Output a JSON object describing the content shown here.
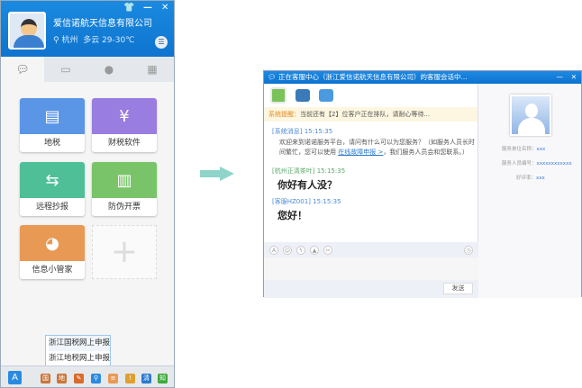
{
  "left_panel": {
    "company": "爱信诺航天信息有限公司",
    "location": "杭州",
    "weather": "多云 29-30℃",
    "tabs": [
      {
        "icon": "chat-icon"
      },
      {
        "icon": "card-icon"
      },
      {
        "icon": "contact-icon"
      },
      {
        "icon": "apps-icon"
      }
    ],
    "tiles": [
      {
        "label": "地税",
        "icon": "tax-doc-icon",
        "color": "#5b95e5"
      },
      {
        "label": "财税软件",
        "icon": "yen-wallet-icon",
        "color": "#9a7de0"
      },
      {
        "label": "远程抄报",
        "icon": "transfer-arrows-icon",
        "color": "#4fbf98"
      },
      {
        "label": "防伪开票",
        "icon": "invoice-printer-icon",
        "color": "#79c469"
      },
      {
        "label": "信息小管家",
        "icon": "globe-gear-icon",
        "color": "#e89a55"
      }
    ],
    "tooltip": [
      "浙江国税网上申报",
      "浙江地税网上申报"
    ]
  },
  "chat_window": {
    "title": "正在客服中心（浙江爱信诺航天信息有限公司）的客服会话中...",
    "notice_label": "系统提醒：",
    "notice_text": "当前还有【2】位客户正在排队，请耐心等待...",
    "messages": [
      {
        "sender": "[系统消息]",
        "time": "15:15:35",
        "text1": "欢迎来到诺诺服务平台，请问有什么可以为您服务？（如服务人员长时间繁忙，您可以使用",
        "link": "在线故障申报 >",
        "text2": "，我们服务人员会和您联系。）"
      },
      {
        "sender": "[杭州正清茶叶]",
        "time": "15:15:35",
        "text": "你好有人没？"
      },
      {
        "sender": "[客服HZ001]",
        "time": "15:15:35",
        "text": "您好！"
      }
    ],
    "send_label": "发送",
    "side": {
      "unit_label": "服务单位名称：",
      "unit_value": "xxx",
      "staff_label": "服务人员编号：",
      "staff_value": "xxxxxxxxxxxx",
      "rating_label": "好评率：",
      "rating_value": "xxx"
    }
  }
}
